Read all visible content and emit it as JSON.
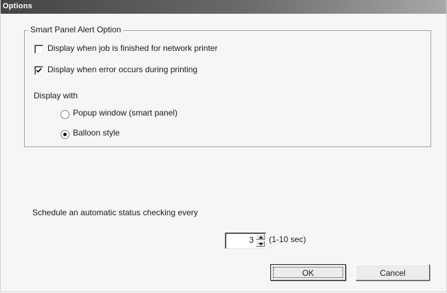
{
  "window": {
    "title": "Options"
  },
  "group": {
    "title": "Smart Panel Alert Option",
    "options": [
      {
        "label": "Display when job is finished for network printer",
        "checked": false
      },
      {
        "label": "Display when error occurs during printing",
        "checked": true
      }
    ],
    "display_with_label": "Display with",
    "display_choices": [
      {
        "label": "Popup window (smart panel)",
        "selected": false
      },
      {
        "label": "Balloon style",
        "selected": true
      }
    ]
  },
  "schedule": {
    "label": "Schedule an automatic status checking every",
    "interval_value": "3",
    "range_hint": "(1-10 sec)"
  },
  "buttons": {
    "ok_label": "OK",
    "cancel_label": "Cancel"
  }
}
